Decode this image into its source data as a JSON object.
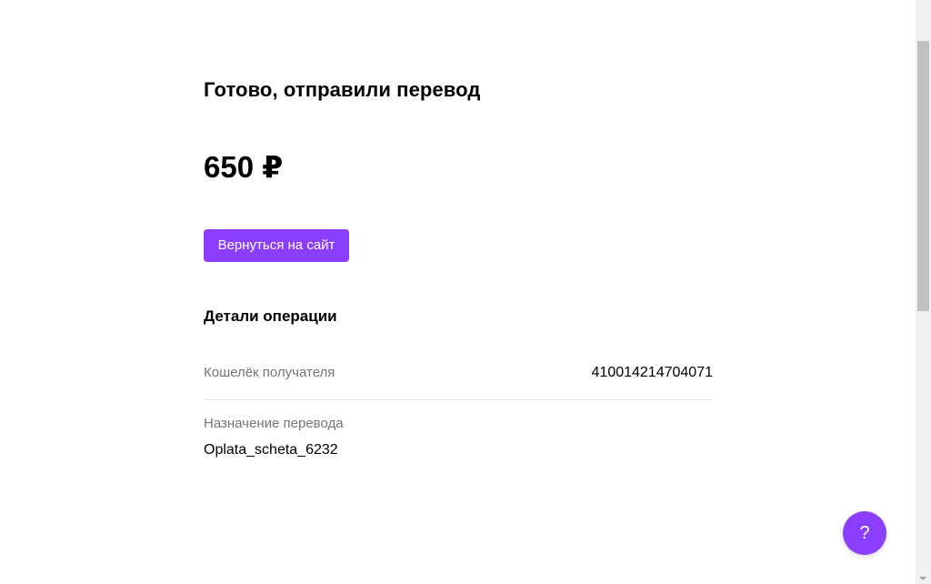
{
  "status": {
    "title": "Готово, отправили перевод",
    "amount": "650 ₽"
  },
  "actions": {
    "back_label": "Вернуться на сайт"
  },
  "details": {
    "title": "Детали операции",
    "wallet": {
      "label": "Кошелёк получателя",
      "value": "410014214704071"
    },
    "purpose": {
      "label": "Назначение перевода",
      "value": "Oplata_scheta_6232"
    }
  },
  "help": {
    "label": "?"
  },
  "colors": {
    "accent": "#8b3ffd",
    "muted_text": "#757575",
    "divider": "#e6e6e6"
  }
}
